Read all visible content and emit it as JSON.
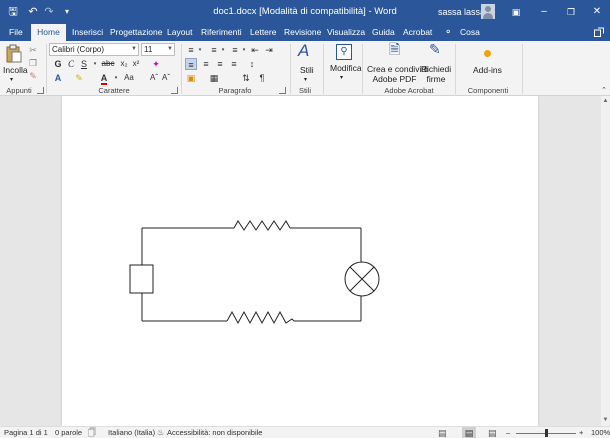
{
  "titlebar": {
    "title": "doc1.docx [Modalità di compatibilità] - Word",
    "user": "sassa lassa",
    "icons": [
      "save-icon",
      "undo-icon",
      "redo-icon",
      "customize-icon"
    ]
  },
  "tabs": [
    "File",
    "Home",
    "Inserisci",
    "Progettazione",
    "Layout",
    "Riferimenti",
    "Lettere",
    "Revisione",
    "Visualizza",
    "Guida",
    "Acrobat"
  ],
  "search": {
    "label": "Cosa vuoi fare?"
  },
  "ribbon": {
    "clipboard": {
      "paste_label": "Incolla",
      "group_label": "Appunti"
    },
    "font": {
      "font_name": "Calibri (Corpo)",
      "font_size": "11",
      "group_label": "Carattere"
    },
    "paragraph": {
      "group_label": "Paragrafo"
    },
    "styles": {
      "label": "Stili",
      "group_label": "Stili"
    },
    "editing": {
      "label": "Modifica"
    },
    "acrobat": {
      "create_label_1": "Crea e condividi",
      "create_label_2": "Adobe PDF",
      "sign_label_1": "Richiedi",
      "sign_label_2": "firme",
      "group_label": "Adobe Acrobat"
    },
    "addins": {
      "label": "Add-ins",
      "group_label": "Componenti aggiuntivi"
    }
  },
  "status": {
    "page": "Pagina 1 di 1",
    "words": "0 parole",
    "language": "Italiano (Italia)",
    "accessibility": "Accessibilità: non disponibile",
    "zoom": "100%",
    "zoom_level": 0.5
  },
  "colors": {
    "accent": "#2b579a",
    "ribbon": "#f3f3f3",
    "workspace": "#e6e6e6",
    "addin": "#f0a30a",
    "font_color_red": "#e00000"
  }
}
